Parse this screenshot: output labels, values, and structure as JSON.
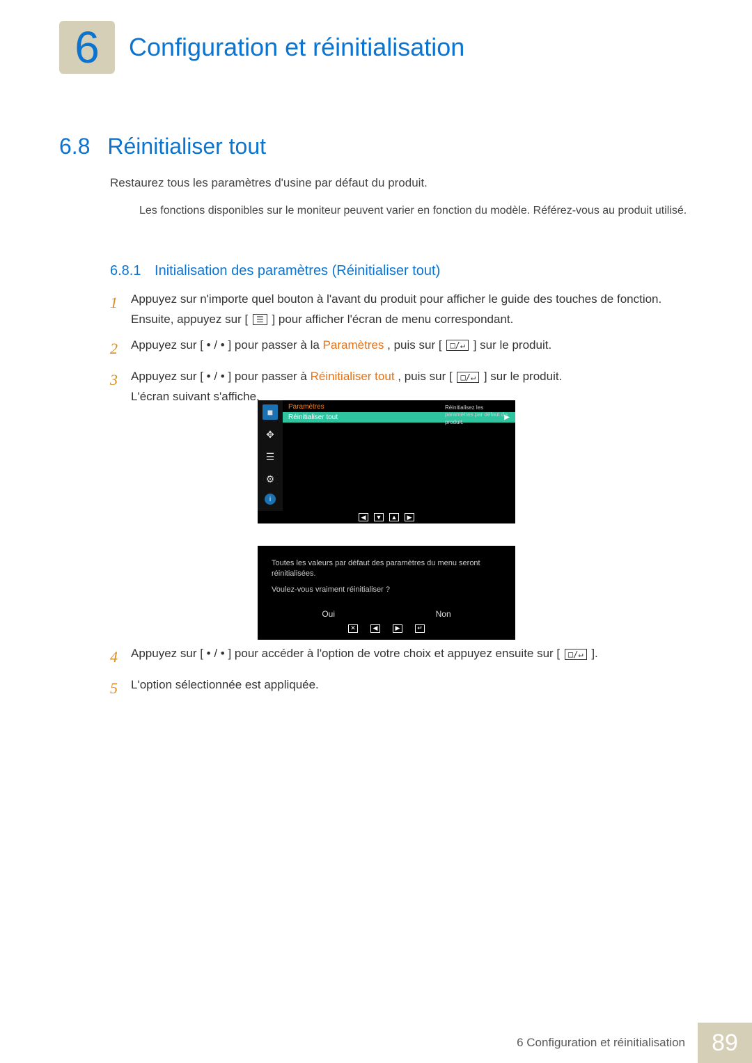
{
  "chapter": {
    "number": "6",
    "title": "Configuration et réinitialisation"
  },
  "section": {
    "number": "6.8",
    "title": "Réinitialiser tout"
  },
  "intro": "Restaurez tous les paramètres d'usine par défaut du produit.",
  "note": "Les fonctions disponibles sur le moniteur peuvent varier en fonction du modèle. Référez-vous au produit utilisé.",
  "subsection": {
    "number": "6.8.1",
    "title": "Initialisation des paramètres (Réinitialiser tout)"
  },
  "steps_a": {
    "s1_a": "Appuyez sur n'importe quel bouton à l'avant du produit pour afficher le guide des touches de fonction. Ensuite, appuyez sur [",
    "s1_icon": "☰",
    "s1_b": "] pour afficher l'écran de menu correspondant.",
    "s2_a": "Appuyez sur [ • / • ] pour passer à la ",
    "s2_hl": "Paramètres",
    "s2_b": ", puis sur [",
    "s2_icon": "□/↵",
    "s2_c": "] sur le produit.",
    "s3_a": "Appuyez sur [ • / • ] pour passer à ",
    "s3_hl": "Réinitialiser tout",
    "s3_b": ", puis sur [",
    "s3_icon": "□/↵",
    "s3_c": "] sur le produit.",
    "s3_d": "L'écran suivant s'affiche."
  },
  "osd1": {
    "title": "Paramètres",
    "row": "Réinitialiser tout",
    "arrow": "▶",
    "help": "Réinitialisez les paramètres par défaut du produit.",
    "nav": {
      "left": "◀",
      "down": "▼",
      "up": "▲",
      "right": "▶"
    },
    "icons": {
      "monitor": "■",
      "move": "✥",
      "list": "☰",
      "gear": "⚙",
      "info": "i"
    }
  },
  "osd2": {
    "msg1": "Toutes les valeurs par défaut des paramètres du menu seront réinitialisées.",
    "msg2": "Voulez-vous vraiment réinitialiser ?",
    "yes": "Oui",
    "no": "Non",
    "nav": {
      "close": "✕",
      "left": "◀",
      "right": "▶",
      "enter": "↵"
    }
  },
  "steps_b": {
    "s4_a": "Appuyez sur [ • / • ] pour accéder à l'option de votre choix et appuyez ensuite sur [",
    "s4_icon": "□/↵",
    "s4_b": "].",
    "s5": "L'option sélectionnée est appliquée."
  },
  "footer": {
    "text": "6 Configuration et réinitialisation",
    "page": "89"
  }
}
